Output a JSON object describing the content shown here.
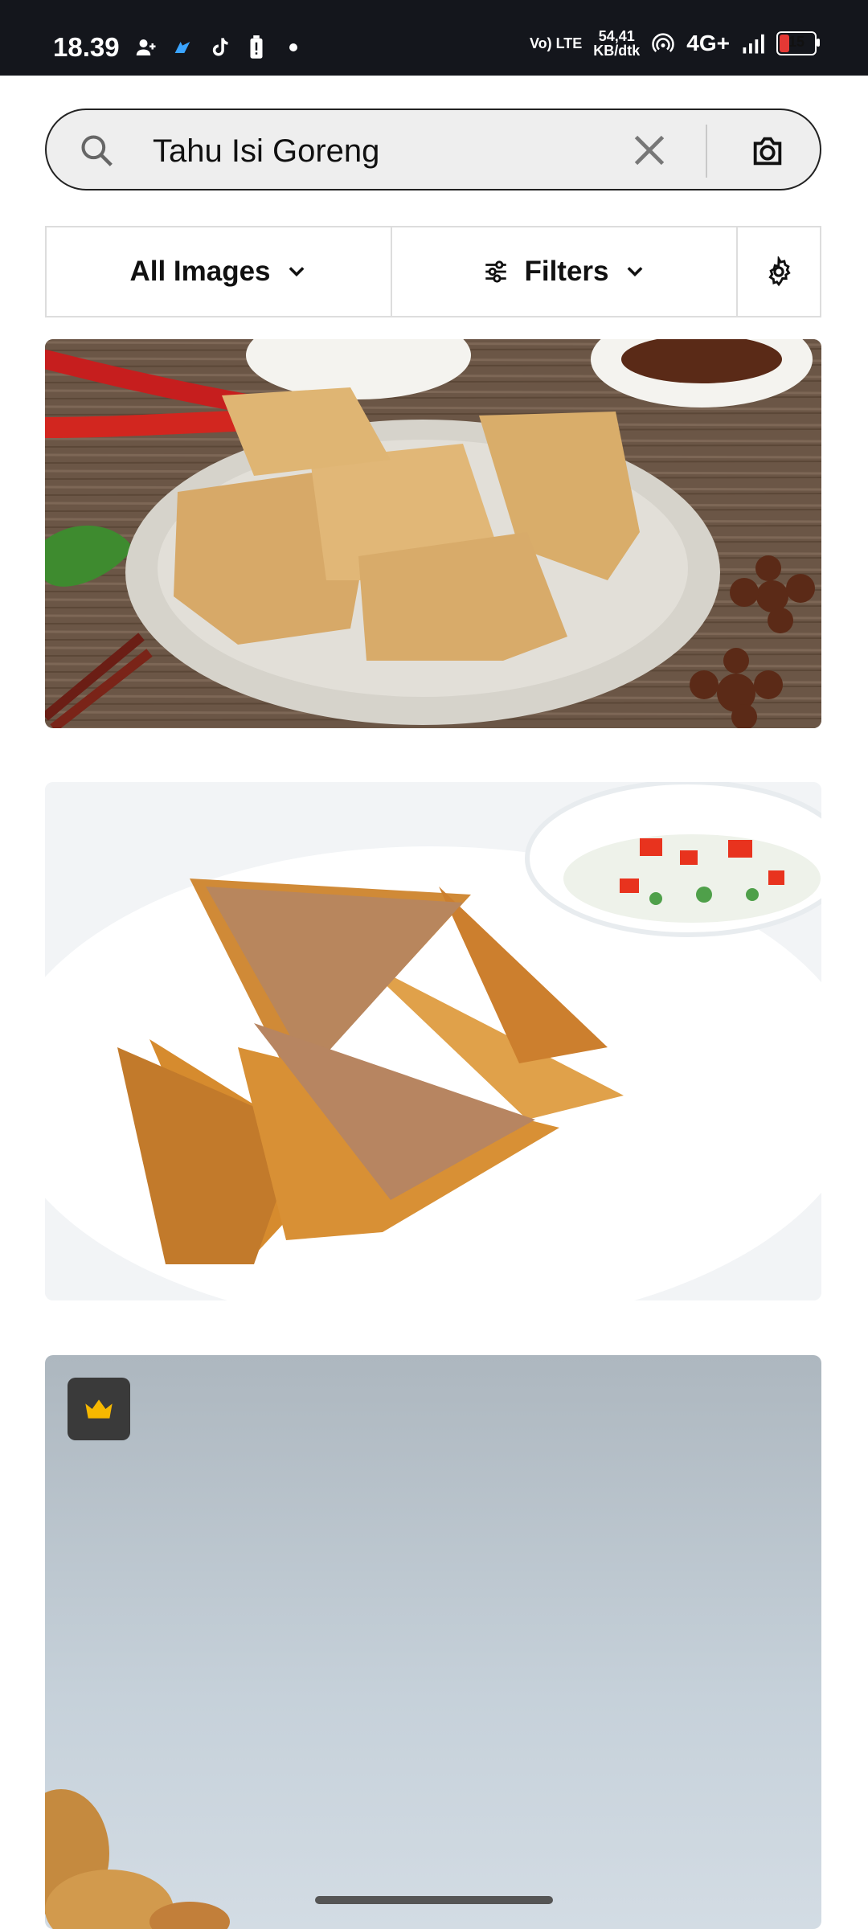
{
  "status_bar": {
    "time": "18.39",
    "net_type": "Vo) LTE",
    "speed_value": "54,41",
    "speed_unit": "KB/dtk",
    "network": "4G+",
    "battery": "15"
  },
  "search": {
    "query": "Tahu Isi Goreng",
    "icons": {
      "search": "search-icon",
      "clear": "close-icon",
      "camera": "camera-icon"
    }
  },
  "filters": {
    "images_label": "All Images",
    "filters_label": "Filters",
    "icons": {
      "dropdown": "chevron-down-icon",
      "filters": "sliders-icon",
      "settings": "gear-icon"
    }
  },
  "results": {
    "items": [
      {
        "id": "result-1",
        "alt": "fried tofu on plate"
      },
      {
        "id": "result-2",
        "alt": "stuffed fried tofu triangles"
      },
      {
        "id": "result-3",
        "alt": "fried food on grey background",
        "badge": "crown-icon"
      }
    ]
  },
  "colors": {
    "status_bar_bg": "#14161c",
    "search_bg": "#eeeeee",
    "premium_badge_bg": "#3a3a3a",
    "premium_crown": "#f6b800"
  }
}
